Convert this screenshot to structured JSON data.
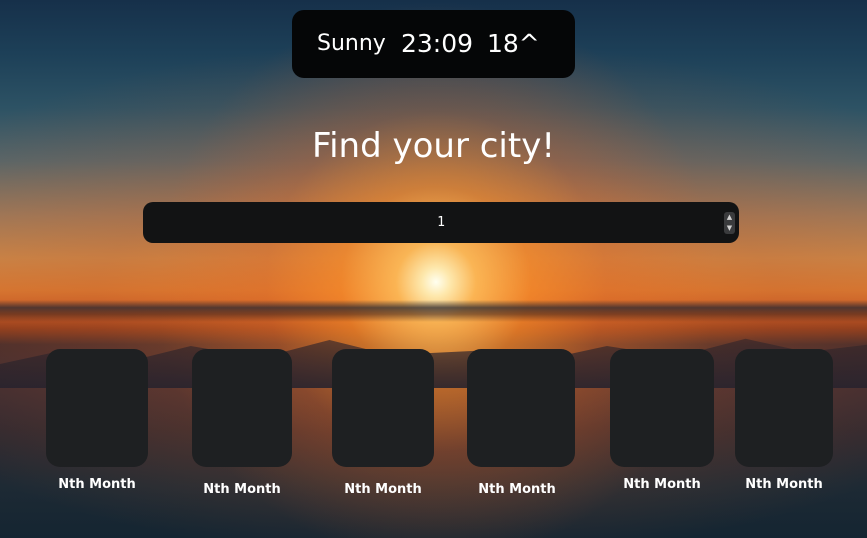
{
  "status": {
    "weather": "Sunny",
    "time": "23:09",
    "temperature": "18^"
  },
  "headline": "Find your city!",
  "city_input": {
    "value": "1"
  },
  "months": [
    {
      "label": "Nth Month"
    },
    {
      "label": "Nth Month"
    },
    {
      "label": "Nth Month"
    },
    {
      "label": "Nth Month"
    },
    {
      "label": "Nth Month"
    },
    {
      "label": "Nth Month"
    }
  ],
  "colors": {
    "panel": "#050607",
    "input_bg": "#121314",
    "card_bg": "#1e2022",
    "text": "#ffffff"
  },
  "icons": {
    "spinner_up": "caret-up-icon",
    "spinner_down": "caret-down-icon"
  }
}
